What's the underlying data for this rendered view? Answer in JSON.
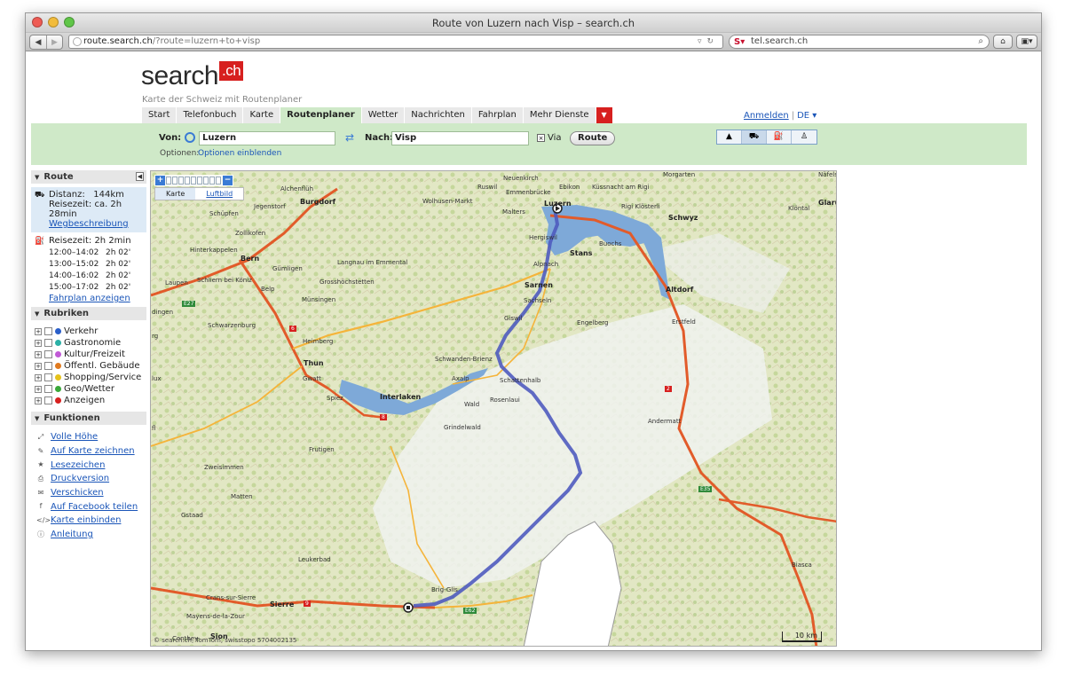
{
  "browser": {
    "window_title": "Route von Luzern nach Visp – search.ch",
    "url_host": "route.search.ch",
    "url_path": "/?route=luzern+to+visp",
    "search_text": "tel.search.ch"
  },
  "site": {
    "logo_text": "search",
    "logo_suffix": ".ch",
    "tagline": "Karte der Schweiz mit Routenplaner",
    "tabs": [
      "Start",
      "Telefonbuch",
      "Karte",
      "Routenplaner",
      "Wetter",
      "Nachrichten",
      "Fahrplan",
      "Mehr Dienste"
    ],
    "active_tab": "Routenplaner",
    "login": "Anmelden",
    "language": "DE ▾"
  },
  "form": {
    "from_label": "Von:",
    "from_value": "Luzern",
    "to_label": "Nach:",
    "to_value": "Visp",
    "via_label": "Via",
    "route_button": "Route",
    "options_label": "Optionen:",
    "options_link": "Optionen einblenden"
  },
  "sidebar": {
    "route_title": "Route",
    "distance_label": "Distanz:",
    "distance_value": "144km",
    "drive_time": "Reisezeit: ca. 2h 28min",
    "directions_link": "Wegbeschreibung",
    "transit_time": "Reisezeit: 2h 2min",
    "schedule": [
      {
        "time": "12:00–14:02",
        "dur": "2h 02'"
      },
      {
        "time": "13:00–15:02",
        "dur": "2h 02'"
      },
      {
        "time": "14:00–16:02",
        "dur": "2h 02'"
      },
      {
        "time": "15:00–17:02",
        "dur": "2h 02'"
      }
    ],
    "schedule_link": "Fahrplan anzeigen",
    "rubriken_title": "Rubriken",
    "rubriken": [
      {
        "label": "Verkehr",
        "color": "#2a5fc9"
      },
      {
        "label": "Gastronomie",
        "color": "#2bb0a6"
      },
      {
        "label": "Kultur/Freizeit",
        "color": "#c15ad6"
      },
      {
        "label": "Öffentl. Gebäude",
        "color": "#e07a1f"
      },
      {
        "label": "Shopping/Service",
        "color": "#e6c21a"
      },
      {
        "label": "Geo/Wetter",
        "color": "#3aa83a"
      },
      {
        "label": "Anzeigen",
        "color": "#d7201f"
      }
    ],
    "funktionen_title": "Funktionen",
    "funktionen": [
      {
        "label": "Volle Höhe",
        "icon": "expand-icon"
      },
      {
        "label": "Auf Karte zeichnen",
        "icon": "pencil-icon"
      },
      {
        "label": "Lesezeichen",
        "icon": "star-icon"
      },
      {
        "label": "Druckversion",
        "icon": "print-icon"
      },
      {
        "label": "Verschicken",
        "icon": "mail-icon"
      },
      {
        "label": "Auf Facebook teilen",
        "icon": "facebook-icon"
      },
      {
        "label": "Karte einbinden",
        "icon": "embed-icon"
      },
      {
        "label": "Anleitung",
        "icon": "info-icon"
      }
    ]
  },
  "map": {
    "tab_map": "Karte",
    "tab_aerial": "Luftbild",
    "copyright": "© search.ch, TomTom, swisstopo 5704002135",
    "scale": "10 km",
    "places": {
      "luzern": "Luzern",
      "ebikon": "Ebikon",
      "kussnacht": "Küssnacht am Rigi",
      "morgarten": "Morgarten",
      "nafels": "Näfels",
      "neuenkirch": "Neuenkirch",
      "emmenbrucke": "Emmenbrücke",
      "ruswil": "Ruswil",
      "malters": "Malters",
      "rigi": "Rigi Klösterli",
      "schwyz": "Schwyz",
      "klontal": "Klöntal",
      "glarus": "Glaru",
      "wolhusen": "Wolhusen-Markt",
      "hergiswil": "Hergiswil",
      "buochs": "Buochs",
      "stans": "Stans",
      "alpnach": "Alpnach",
      "sarnen": "Sarnen",
      "sachseln": "Sachseln",
      "altdorf": "Altdorf",
      "giswil": "Giswil",
      "engelberg": "Engelberg",
      "erstfeld": "Erstfeld",
      "burgdorf": "Burgdorf",
      "alchenfluh": "Alchenflüh",
      "jegenstorf": "Jegenstorf",
      "schupfen": "Schüpfen",
      "zollikofen": "Zollikofen",
      "hinterkappelen": "Hinterkappelen",
      "bern": "Bern",
      "gumligen": "Gümligen",
      "langnau": "Langnau im Emmental",
      "laupen": "Laupen",
      "schliern": "Schliern bei Köniz",
      "belp": "Belp",
      "grosshochstetten": "Grosshöchstetten",
      "munsingen": "Münsingen",
      "schwarzenburg": "Schwarzenburg",
      "heimberg": "Heimberg",
      "thun": "Thun",
      "gwatt": "Gwatt",
      "spiez": "Spiez",
      "interlaken": "Interlaken",
      "schwanden": "Schwanden-Brienz",
      "axalp": "Axalp",
      "schattenhalb": "Schattenhalb",
      "rosenlaui": "Rosenlaui",
      "wald": "Wald",
      "grindelwald": "Grindelwald",
      "andermatt": "Andermatt",
      "frutigen": "Frutigen",
      "zweisimmen": "Zweisimmen",
      "matten": "Matten",
      "gstaad": "Gstaad",
      "leukerbad": "Leukerbad",
      "brig": "Brig-Glis",
      "crans": "Crans-sur-Sierre",
      "sierre": "Sierre",
      "mayens": "Mayens-de-la-Zour",
      "sion": "Sion",
      "conthey": "Conthey",
      "biasca": "Biasca",
      "dingen": "dingen",
      "rg": "rg",
      "lux": "lux",
      "fl": "fl"
    },
    "roads": {
      "a2": "2",
      "a6": "6",
      "a8": "8",
      "a9": "9",
      "e27": "E27",
      "e35": "E35",
      "e62": "E62"
    }
  }
}
